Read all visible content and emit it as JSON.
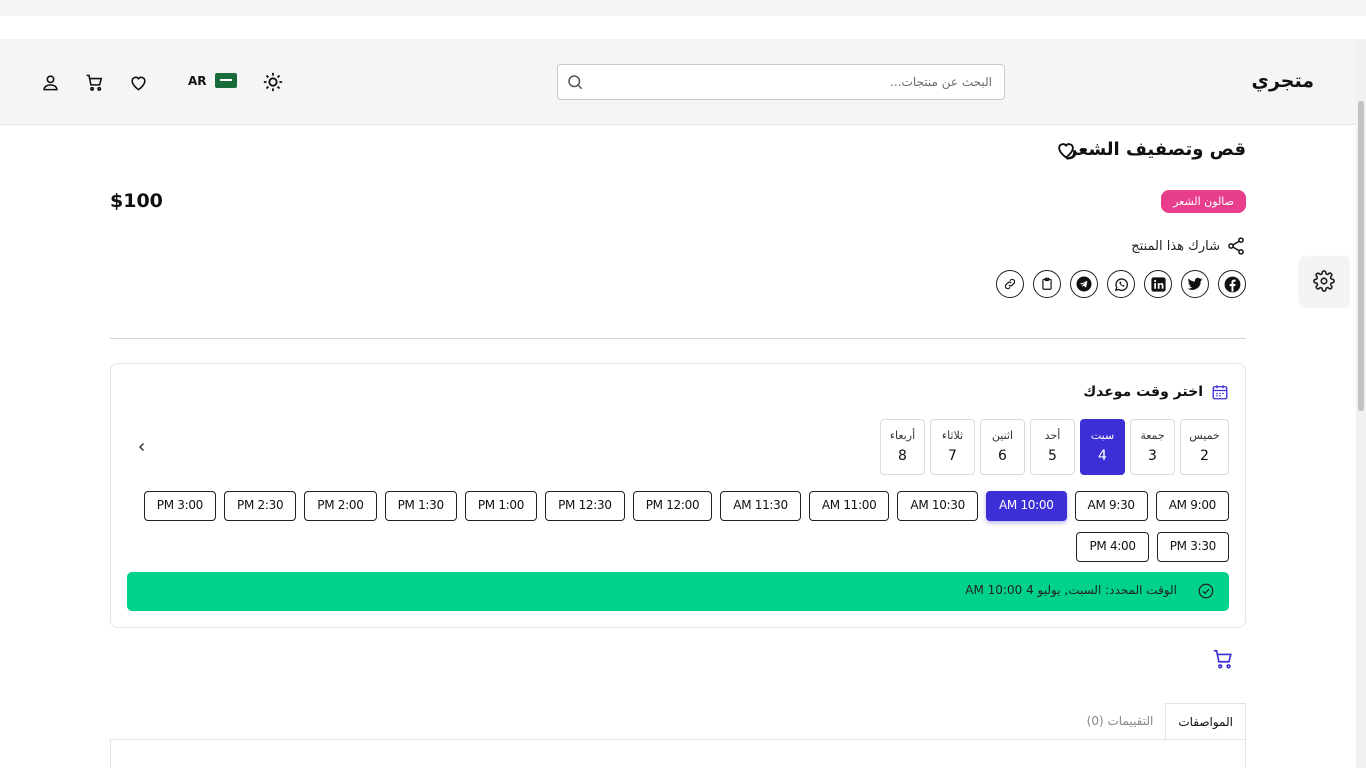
{
  "header": {
    "logo": "متجري",
    "search_placeholder": "البحث عن منتجات...",
    "lang_code": "AR"
  },
  "product": {
    "title": "قص وتصفيف الشعر",
    "price": "$100",
    "category": "صالون الشعر",
    "share_label": "شارك هذا المنتج"
  },
  "booking": {
    "title": "اختر وقت موعدك",
    "days": [
      {
        "name": "خميس",
        "num": "2"
      },
      {
        "name": "جمعة",
        "num": "3"
      },
      {
        "name": "سبت",
        "num": "4"
      },
      {
        "name": "أحد",
        "num": "5"
      },
      {
        "name": "اثنين",
        "num": "6"
      },
      {
        "name": "ثلاثاء",
        "num": "7"
      },
      {
        "name": "أربعاء",
        "num": "8"
      }
    ],
    "selected_day_index": 2,
    "slots": [
      "AM 9:00",
      "AM 9:30",
      "AM 10:00",
      "AM 10:30",
      "AM 11:00",
      "AM 11:30",
      "PM 12:00",
      "PM 12:30",
      "PM 1:00",
      "PM 1:30",
      "PM 2:00",
      "PM 2:30",
      "PM 3:00",
      "PM 3:30",
      "PM 4:00"
    ],
    "selected_slot_index": 2,
    "selected_text": "الوقت المحدد: السبت, يوليو 4 10:00 AM"
  },
  "tabs": {
    "specs": "المواصفات",
    "reviews": "التقييمات (0)"
  },
  "colors": {
    "accent": "#3d2fd6",
    "success": "#00d28c",
    "badge": "#e83e8c"
  }
}
